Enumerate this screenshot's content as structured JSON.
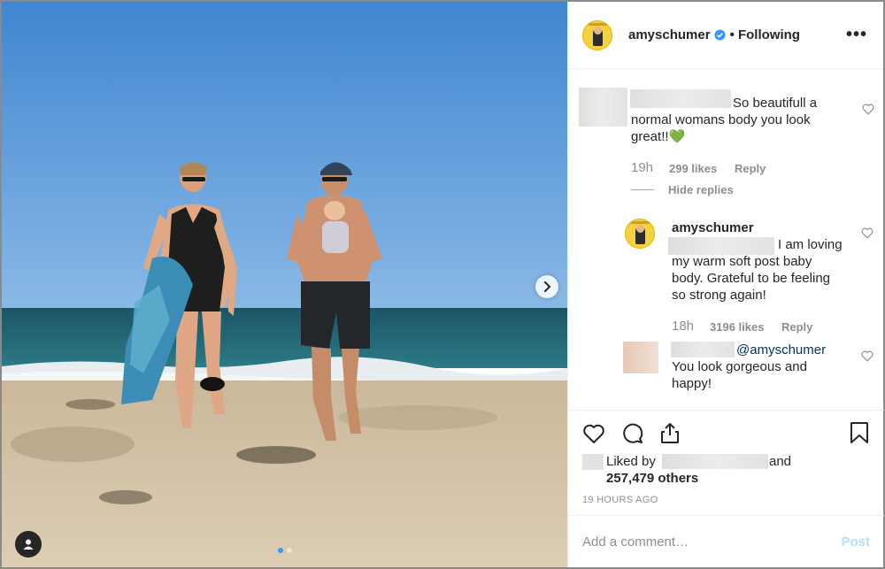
{
  "post": {
    "author": "amyschumer",
    "follow_status": "• Following",
    "more_label": "•••"
  },
  "comments": [
    {
      "text": [
        "So beautifull a",
        "normal womans body you look",
        "great!!💚"
      ],
      "time": "19h",
      "likes": "299 likes",
      "reply_label": "Reply",
      "hide_replies": "Hide replies"
    },
    {
      "author": "amyschumer",
      "text": [
        "I am loving",
        "my warm soft post baby",
        "body. Grateful to be feeling",
        "so strong again!"
      ],
      "time": "18h",
      "likes": "3196 likes",
      "reply_label": "Reply"
    },
    {
      "mention": "@amyschumer",
      "text": [
        "You look gorgeous and",
        "happy!"
      ]
    }
  ],
  "likes": {
    "prefix": "Liked by",
    "and": "and",
    "others": "257,479 others"
  },
  "timestamp": "19 HOURS AGO",
  "add_comment": {
    "placeholder": "Add a comment…",
    "post_label": "Post"
  },
  "colors": {
    "sky": "#4a8fd6",
    "sea": "#1f5f74",
    "sand": "#d6c6aa",
    "link": "#003569",
    "verified": "#3897f0"
  },
  "icons": [
    "next-arrow-icon",
    "user-tag-icon",
    "verified-icon",
    "more-icon",
    "heart-icon",
    "comment-icon",
    "share-icon",
    "bookmark-icon"
  ]
}
